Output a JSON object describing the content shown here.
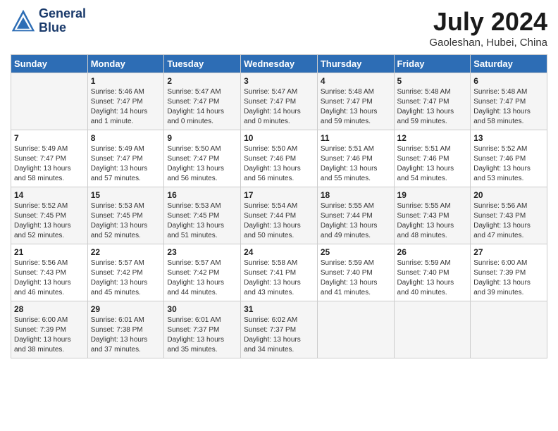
{
  "header": {
    "logo_line1": "General",
    "logo_line2": "Blue",
    "month": "July 2024",
    "location": "Gaoleshan, Hubei, China"
  },
  "days_of_week": [
    "Sunday",
    "Monday",
    "Tuesday",
    "Wednesday",
    "Thursday",
    "Friday",
    "Saturday"
  ],
  "weeks": [
    [
      {
        "day": "",
        "info": ""
      },
      {
        "day": "1",
        "info": "Sunrise: 5:46 AM\nSunset: 7:47 PM\nDaylight: 14 hours\nand 1 minute."
      },
      {
        "day": "2",
        "info": "Sunrise: 5:47 AM\nSunset: 7:47 PM\nDaylight: 14 hours\nand 0 minutes."
      },
      {
        "day": "3",
        "info": "Sunrise: 5:47 AM\nSunset: 7:47 PM\nDaylight: 14 hours\nand 0 minutes."
      },
      {
        "day": "4",
        "info": "Sunrise: 5:48 AM\nSunset: 7:47 PM\nDaylight: 13 hours\nand 59 minutes."
      },
      {
        "day": "5",
        "info": "Sunrise: 5:48 AM\nSunset: 7:47 PM\nDaylight: 13 hours\nand 59 minutes."
      },
      {
        "day": "6",
        "info": "Sunrise: 5:48 AM\nSunset: 7:47 PM\nDaylight: 13 hours\nand 58 minutes."
      }
    ],
    [
      {
        "day": "7",
        "info": "Sunrise: 5:49 AM\nSunset: 7:47 PM\nDaylight: 13 hours\nand 58 minutes."
      },
      {
        "day": "8",
        "info": "Sunrise: 5:49 AM\nSunset: 7:47 PM\nDaylight: 13 hours\nand 57 minutes."
      },
      {
        "day": "9",
        "info": "Sunrise: 5:50 AM\nSunset: 7:47 PM\nDaylight: 13 hours\nand 56 minutes."
      },
      {
        "day": "10",
        "info": "Sunrise: 5:50 AM\nSunset: 7:46 PM\nDaylight: 13 hours\nand 56 minutes."
      },
      {
        "day": "11",
        "info": "Sunrise: 5:51 AM\nSunset: 7:46 PM\nDaylight: 13 hours\nand 55 minutes."
      },
      {
        "day": "12",
        "info": "Sunrise: 5:51 AM\nSunset: 7:46 PM\nDaylight: 13 hours\nand 54 minutes."
      },
      {
        "day": "13",
        "info": "Sunrise: 5:52 AM\nSunset: 7:46 PM\nDaylight: 13 hours\nand 53 minutes."
      }
    ],
    [
      {
        "day": "14",
        "info": "Sunrise: 5:52 AM\nSunset: 7:45 PM\nDaylight: 13 hours\nand 52 minutes."
      },
      {
        "day": "15",
        "info": "Sunrise: 5:53 AM\nSunset: 7:45 PM\nDaylight: 13 hours\nand 52 minutes."
      },
      {
        "day": "16",
        "info": "Sunrise: 5:53 AM\nSunset: 7:45 PM\nDaylight: 13 hours\nand 51 minutes."
      },
      {
        "day": "17",
        "info": "Sunrise: 5:54 AM\nSunset: 7:44 PM\nDaylight: 13 hours\nand 50 minutes."
      },
      {
        "day": "18",
        "info": "Sunrise: 5:55 AM\nSunset: 7:44 PM\nDaylight: 13 hours\nand 49 minutes."
      },
      {
        "day": "19",
        "info": "Sunrise: 5:55 AM\nSunset: 7:43 PM\nDaylight: 13 hours\nand 48 minutes."
      },
      {
        "day": "20",
        "info": "Sunrise: 5:56 AM\nSunset: 7:43 PM\nDaylight: 13 hours\nand 47 minutes."
      }
    ],
    [
      {
        "day": "21",
        "info": "Sunrise: 5:56 AM\nSunset: 7:43 PM\nDaylight: 13 hours\nand 46 minutes."
      },
      {
        "day": "22",
        "info": "Sunrise: 5:57 AM\nSunset: 7:42 PM\nDaylight: 13 hours\nand 45 minutes."
      },
      {
        "day": "23",
        "info": "Sunrise: 5:57 AM\nSunset: 7:42 PM\nDaylight: 13 hours\nand 44 minutes."
      },
      {
        "day": "24",
        "info": "Sunrise: 5:58 AM\nSunset: 7:41 PM\nDaylight: 13 hours\nand 43 minutes."
      },
      {
        "day": "25",
        "info": "Sunrise: 5:59 AM\nSunset: 7:40 PM\nDaylight: 13 hours\nand 41 minutes."
      },
      {
        "day": "26",
        "info": "Sunrise: 5:59 AM\nSunset: 7:40 PM\nDaylight: 13 hours\nand 40 minutes."
      },
      {
        "day": "27",
        "info": "Sunrise: 6:00 AM\nSunset: 7:39 PM\nDaylight: 13 hours\nand 39 minutes."
      }
    ],
    [
      {
        "day": "28",
        "info": "Sunrise: 6:00 AM\nSunset: 7:39 PM\nDaylight: 13 hours\nand 38 minutes."
      },
      {
        "day": "29",
        "info": "Sunrise: 6:01 AM\nSunset: 7:38 PM\nDaylight: 13 hours\nand 37 minutes."
      },
      {
        "day": "30",
        "info": "Sunrise: 6:01 AM\nSunset: 7:37 PM\nDaylight: 13 hours\nand 35 minutes."
      },
      {
        "day": "31",
        "info": "Sunrise: 6:02 AM\nSunset: 7:37 PM\nDaylight: 13 hours\nand 34 minutes."
      },
      {
        "day": "",
        "info": ""
      },
      {
        "day": "",
        "info": ""
      },
      {
        "day": "",
        "info": ""
      }
    ]
  ]
}
